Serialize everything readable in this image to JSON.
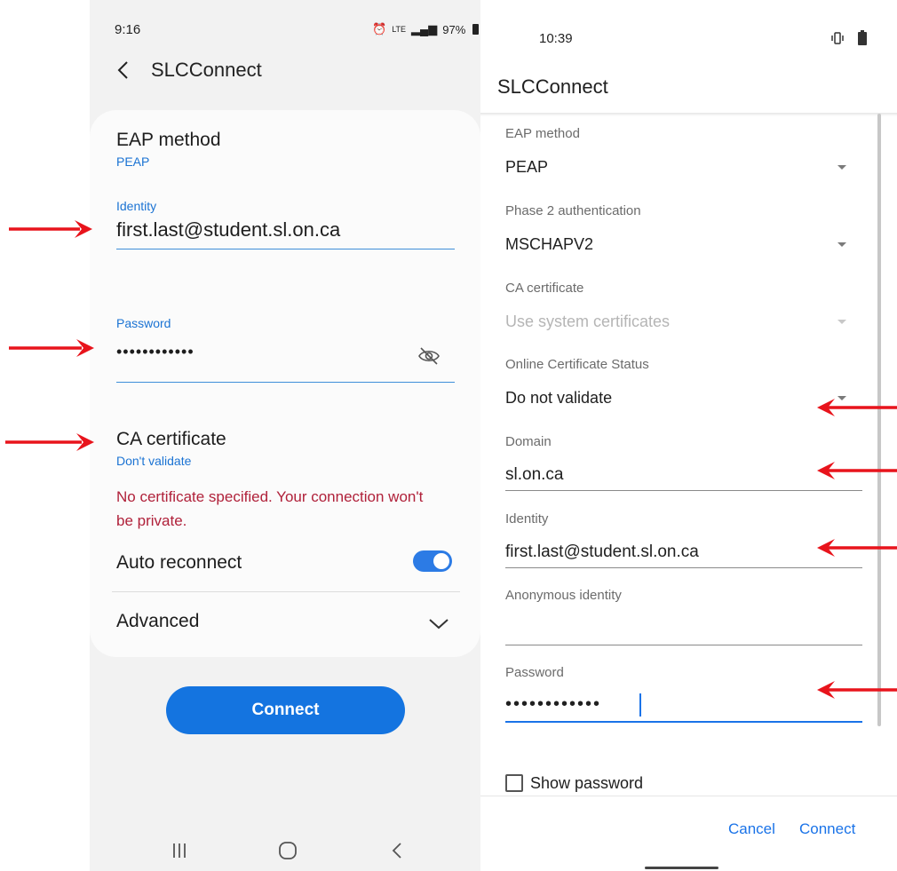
{
  "left": {
    "status": {
      "time": "9:16",
      "network": "LTE",
      "battery": "97%"
    },
    "title": "SLCConnect",
    "eap": {
      "label": "EAP method",
      "value": "PEAP"
    },
    "identity": {
      "label": "Identity",
      "value": "first.last@student.sl.on.ca"
    },
    "password": {
      "label": "Password",
      "value": "••••••••••••"
    },
    "ca": {
      "label": "CA certificate",
      "value": "Don't validate"
    },
    "warning": {
      "line1": "No certificate specified. Your connection won't",
      "line2": "be private."
    },
    "auto_reconnect": {
      "label": "Auto reconnect",
      "on": true
    },
    "advanced": {
      "label": "Advanced"
    },
    "connect_label": "Connect"
  },
  "right": {
    "status": {
      "time": "10:39"
    },
    "title": "SLCConnect",
    "eap": {
      "label": "EAP method",
      "value": "PEAP"
    },
    "phase2": {
      "label": "Phase 2 authentication",
      "value": "MSCHAPV2"
    },
    "ca": {
      "label": "CA certificate",
      "value": "Use system certificates"
    },
    "ocsp": {
      "label": "Online Certificate Status",
      "value": "Do not validate"
    },
    "domain": {
      "label": "Domain",
      "value": "sl.on.ca"
    },
    "identity": {
      "label": "Identity",
      "value": "first.last@student.sl.on.ca"
    },
    "anon": {
      "label": "Anonymous identity",
      "value": ""
    },
    "password": {
      "label": "Password",
      "value": "••••••••••••"
    },
    "show_password": "Show password",
    "cancel_label": "Cancel",
    "connect_label": "Connect"
  },
  "colors": {
    "annotation_arrow": "#e8141c",
    "accent_blue": "#1a73e8",
    "warning_red": "#b0213a"
  }
}
